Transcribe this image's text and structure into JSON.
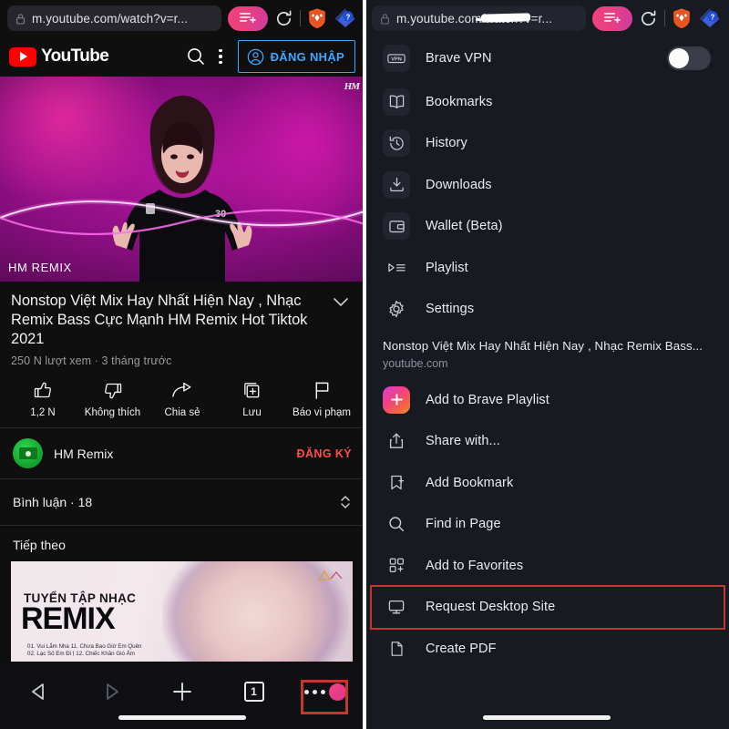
{
  "left_panel": {
    "address_bar": {
      "url": "m.youtube.com/watch?v=r...",
      "lock_icon": "lock-icon",
      "reader_button_icon": "reader-mode-icon",
      "reload_icon": "reload-icon",
      "brave_shield_icon": "brave-lion-icon",
      "help_icon": "help-shield-icon"
    },
    "youtube_header": {
      "logo_text": "YouTube",
      "search_icon": "search-icon",
      "kebab_icon": "more-vertical-icon",
      "signin_label": "ĐĂNG NHẬP",
      "signin_account_icon": "account-circle-icon"
    },
    "player": {
      "watermark": "HM",
      "overlay_label": "HM REMIX"
    },
    "video": {
      "title": "Nonstop Việt Mix Hay Nhất Hiện Nay , Nhạc Remix Bass Cực Mạnh HM Remix Hot Tiktok 2021",
      "meta": "250 N lượt xem · 3 tháng trước",
      "expand_icon": "chevron-down-icon",
      "actions": [
        {
          "label": "1,2 N",
          "icon": "thumbs-up-icon"
        },
        {
          "label": "Không thích",
          "icon": "thumbs-down-icon"
        },
        {
          "label": "Chia sẻ",
          "icon": "share-icon"
        },
        {
          "label": "Lưu",
          "icon": "save-to-playlist-icon"
        },
        {
          "label": "Báo vi phạm",
          "icon": "flag-icon"
        }
      ]
    },
    "channel": {
      "name": "HM Remix",
      "subscribe_label": "ĐĂNG KÝ",
      "subscribe_color": "#ff4e45",
      "avatar_icon": "channel-avatar"
    },
    "comments": {
      "label": "Bình luận · 18",
      "expand_icon": "chevron-updown-icon"
    },
    "up_next": {
      "label": "Tiếp theo",
      "thumbnail": {
        "line1": "TUYỂN TẬP NHẠC",
        "line2": "REMIX",
        "tracks": [
          "01. Vui Lắm Nha    11. Chưa Bao Giờ Em Quên",
          "02. Lạc Số Em Đi Ị 12. Chiếc Khăn Gió Ấm"
        ]
      }
    },
    "bottom_toolbar": {
      "back_icon": "back-arrow-icon",
      "forward_icon": "forward-arrow-icon",
      "new_tab_icon": "plus-icon",
      "tab_count": "1",
      "more_icon": "more-horizontal-icon",
      "brave_badge_icon": "brave-menu-badge"
    },
    "highlight_color": "#c0392b"
  },
  "right_panel": {
    "address_bar": {
      "url": "m.youtube.com/watch?v=r...",
      "redacted": true,
      "lock_icon": "lock-icon",
      "reader_button_icon": "reader-mode-icon",
      "reload_icon": "reload-icon",
      "brave_shield_icon": "brave-lion-icon",
      "help_icon": "help-shield-icon"
    },
    "vpn": {
      "label": "Brave VPN",
      "icon": "vpn-icon",
      "toggle_on": false
    },
    "menu_items": [
      {
        "label": "Bookmarks",
        "icon": "bookmarks-icon"
      },
      {
        "label": "History",
        "icon": "history-icon"
      },
      {
        "label": "Downloads",
        "icon": "downloads-icon"
      },
      {
        "label": "Wallet (Beta)",
        "icon": "wallet-icon"
      },
      {
        "label": "Playlist",
        "icon": "playlist-icon"
      },
      {
        "label": "Settings",
        "icon": "settings-gear-icon"
      }
    ],
    "page_info": {
      "title": "Nonstop Việt Mix Hay Nhất Hiện Nay , Nhạc Remix Bass...",
      "host": "youtube.com"
    },
    "page_actions": [
      {
        "label": "Add to Brave Playlist",
        "icon": "add-to-playlist-icon",
        "highlighted": false
      },
      {
        "label": "Share with...",
        "icon": "share-icon",
        "highlighted": false
      },
      {
        "label": "Add Bookmark",
        "icon": "add-bookmark-icon",
        "highlighted": false
      },
      {
        "label": "Find in Page",
        "icon": "search-icon",
        "highlighted": false
      },
      {
        "label": "Add to Favorites",
        "icon": "add-to-favorites-icon",
        "highlighted": false
      },
      {
        "label": "Request Desktop Site",
        "icon": "desktop-monitor-icon",
        "highlighted": true
      },
      {
        "label": "Create PDF",
        "icon": "document-icon",
        "highlighted": false
      }
    ],
    "highlight_color": "#c0392b"
  }
}
